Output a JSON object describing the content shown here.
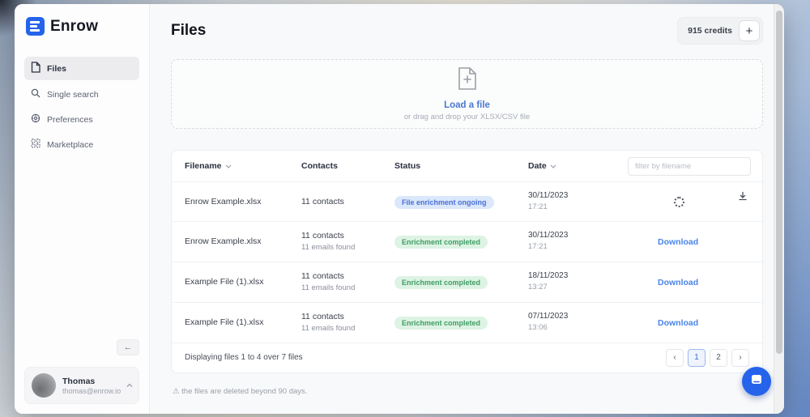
{
  "app": {
    "brand": "Enrow"
  },
  "header": {
    "title": "Files",
    "credits": "915 credits",
    "add_credits": "+"
  },
  "sidebar": {
    "items": [
      {
        "label": "Files",
        "icon": "file",
        "active": true
      },
      {
        "label": "Single search",
        "icon": "search",
        "active": false
      },
      {
        "label": "Preferences",
        "icon": "preferences",
        "active": false
      },
      {
        "label": "Marketplace",
        "icon": "marketplace",
        "active": false
      }
    ],
    "collapse_glyph": "←",
    "user": {
      "name": "Thomas",
      "email": "thomas@enrow.io"
    }
  },
  "upload": {
    "link": "Load a file",
    "hint": "or drag and drop your XLSX/CSV file"
  },
  "table": {
    "columns": [
      {
        "label": "Filename",
        "sortable": true
      },
      {
        "label": "Contacts",
        "sortable": false
      },
      {
        "label": "Status",
        "sortable": false
      },
      {
        "label": "Date",
        "sortable": true
      }
    ],
    "filter_placeholder": "filter by filename",
    "rows": [
      {
        "filename": "Enrow Example.xlsx",
        "contacts": "11 contacts",
        "contacts_sub": "",
        "status": "File enrichment ongoing",
        "status_type": "ongoing",
        "date": "30/11/2023",
        "time": "17:21",
        "action": "spinner",
        "trailing_icon": "download-arrow"
      },
      {
        "filename": "Enrow Example.xlsx",
        "contacts": "11 contacts",
        "contacts_sub": "11 emails found",
        "status": "Enrichment completed",
        "status_type": "completed",
        "date": "30/11/2023",
        "time": "17:21",
        "action": "Download"
      },
      {
        "filename": "Example File (1).xlsx",
        "contacts": "11 contacts",
        "contacts_sub": "11 emails found",
        "status": "Enrichment completed",
        "status_type": "completed",
        "date": "18/11/2023",
        "time": "13:27",
        "action": "Download"
      },
      {
        "filename": "Example File (1).xlsx",
        "contacts": "11 contacts",
        "contacts_sub": "11 emails found",
        "status": "Enrichment completed",
        "status_type": "completed",
        "date": "07/11/2023",
        "time": "13:06",
        "action": "Download"
      }
    ],
    "footer": {
      "summary": "Displaying files 1 to 4 over 7 files",
      "pagination": [
        {
          "label": "‹",
          "active": false
        },
        {
          "label": "1",
          "active": true
        },
        {
          "label": "2",
          "active": false
        },
        {
          "label": "›",
          "active": false
        }
      ]
    }
  },
  "note": "⚠  the files are deleted beyond 90 days.",
  "colors": {
    "accent": "#2563eb",
    "ongoing_bg": "#dbe7fb",
    "ongoing_text": "#4a71d6",
    "completed_bg": "#ddf3e4",
    "completed_text": "#3f9e63",
    "link": "#4a84e8"
  }
}
